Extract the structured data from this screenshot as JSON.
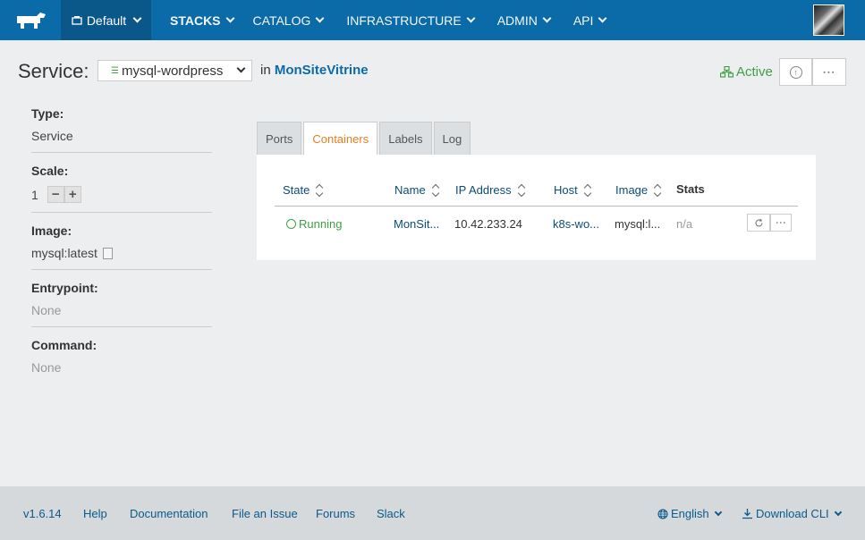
{
  "topbar": {
    "environment": "Default",
    "nav": [
      {
        "label": "STACKS",
        "active": true
      },
      {
        "label": "CATALOG",
        "active": false
      },
      {
        "label": "INFRASTRUCTURE",
        "active": false
      },
      {
        "label": "ADMIN",
        "active": false
      },
      {
        "label": "API",
        "active": false
      }
    ]
  },
  "header": {
    "service_label": "Service:",
    "service_name": "mysql-wordpress",
    "in_prefix": "in",
    "stack_name": "MonSiteVitrine",
    "state": "Active",
    "state_color": "#41a045"
  },
  "sidebar": {
    "type_title": "Type:",
    "type_value": "Service",
    "scale_title": "Scale:",
    "scale_value": "1",
    "image_title": "Image:",
    "image_value": "mysql:latest",
    "entrypoint_title": "Entrypoint:",
    "entrypoint_value": "None",
    "command_title": "Command:",
    "command_value": "None"
  },
  "tabs": [
    {
      "label": "Ports",
      "active": false
    },
    {
      "label": "Containers",
      "active": true
    },
    {
      "label": "Labels",
      "active": false
    },
    {
      "label": "Log",
      "active": false
    }
  ],
  "table": {
    "headers": {
      "state": "State",
      "name": "Name",
      "ip": "IP Address",
      "host": "Host",
      "image": "Image",
      "stats": "Stats"
    },
    "rows": [
      {
        "state": "Running",
        "name": "MonSit...",
        "ip": "10.42.233.24",
        "host": "k8s-wo...",
        "image": "mysql:l...",
        "stats": "n/a"
      }
    ]
  },
  "footer": {
    "version": "v1.6.14",
    "help": "Help",
    "documentation": "Documentation",
    "file_issue": "File an Issue",
    "forums": "Forums",
    "slack": "Slack",
    "language": "English",
    "download_cli": "Download CLI"
  },
  "colors": {
    "nav_bg": "#0b6ba8",
    "accent_tab": "#e67e22",
    "link": "#0b6ba8"
  }
}
